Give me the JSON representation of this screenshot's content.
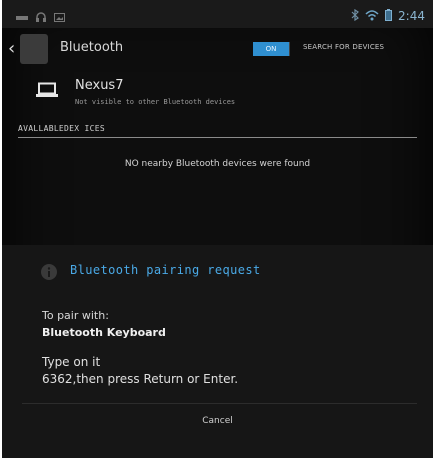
{
  "status_bar": {
    "time": "2:44",
    "icons": [
      "usb-icon",
      "headset-icon",
      "image-icon",
      "bluetooth-icon",
      "wifi-icon",
      "battery-icon"
    ]
  },
  "action_bar": {
    "title": "Bluetooth",
    "toggle_label": "ON",
    "search_label": "SEARCH FOR DEVICES"
  },
  "device": {
    "name": "Nexus7",
    "visibility": "Not visible to other Bluetooth devices"
  },
  "available": {
    "header": "AVALLABLEDEX ICES",
    "empty_message": "NO nearby Bluetooth devices were found"
  },
  "dialog": {
    "title": "Bluetooth pairing request",
    "pair_label": "To pair with:",
    "pair_device": "Bluetooth Keyboard",
    "instruction_line1": "Type on it",
    "instruction_line2": "6362,then press Return or Enter.",
    "cancel_label": "Cancel"
  },
  "colors": {
    "accent": "#2f8fd0",
    "title_blue": "#4aa9e6",
    "background": "#0e0e0e"
  }
}
